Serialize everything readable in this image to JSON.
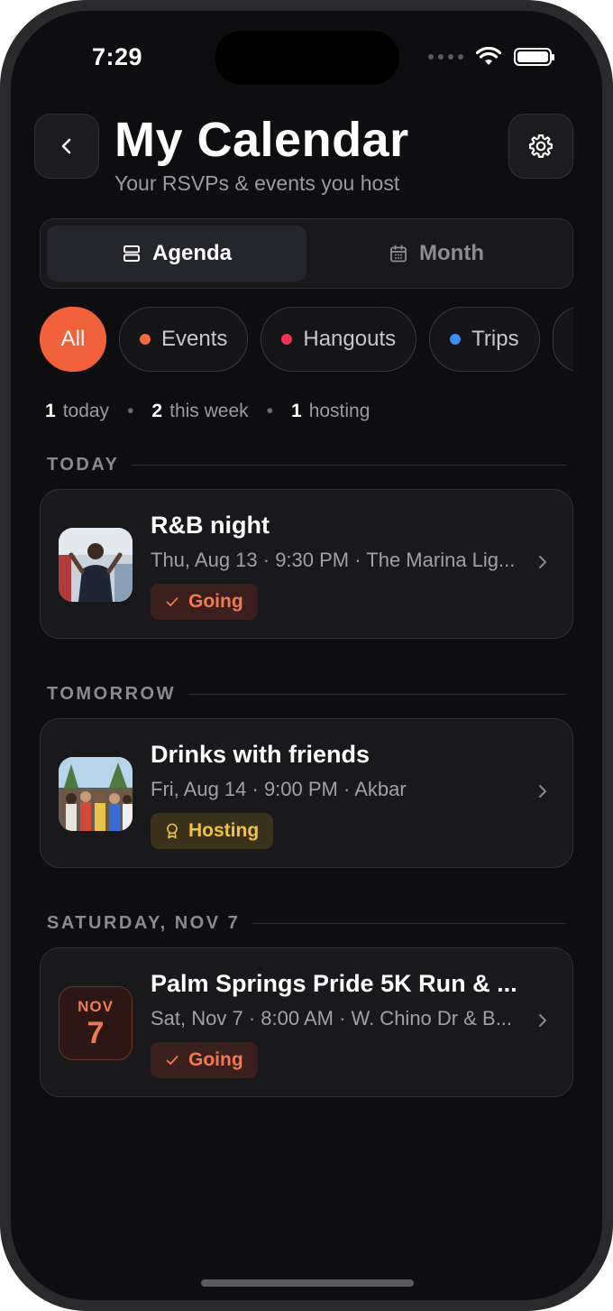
{
  "status_bar": {
    "time": "7:29"
  },
  "header": {
    "title": "My Calendar",
    "subtitle": "Your RSVPs & events you host"
  },
  "view_toggle": {
    "agenda_label": "Agenda",
    "month_label": "Month",
    "selected": "Agenda"
  },
  "filters": [
    {
      "label": "All",
      "selected": true
    },
    {
      "label": "Events",
      "color": "#f26a3d"
    },
    {
      "label": "Hangouts",
      "color": "#f0344e"
    },
    {
      "label": "Trips",
      "color": "#3f8ff5"
    }
  ],
  "stats": {
    "today_count": "1",
    "today_label": "today",
    "week_count": "2",
    "week_label": "this week",
    "hosting_count": "1",
    "hosting_label": "hosting"
  },
  "sections": [
    {
      "heading": "TODAY",
      "event": {
        "title": "R&B night",
        "meta": "Thu, Aug 13 · 9:30 PM · The Marina Lig...",
        "status": "Going"
      }
    },
    {
      "heading": "TOMORROW",
      "event": {
        "title": "Drinks with friends",
        "meta": "Fri, Aug 14 · 9:00 PM · Akbar",
        "status": "Hosting"
      }
    },
    {
      "heading": "SATURDAY, NOV 7",
      "event": {
        "title": "Palm Springs Pride 5K Run & ...",
        "meta": "Sat, Nov 7 · 8:00 AM · W. Chino Dr & B...",
        "status": "Going",
        "date_month": "NOV",
        "date_day": "7"
      }
    }
  ],
  "colors": {
    "accent": "#f0603a",
    "going": "#f07a55",
    "hosting": "#f0c245",
    "background": "#0e0e10",
    "card": "#19191c"
  }
}
